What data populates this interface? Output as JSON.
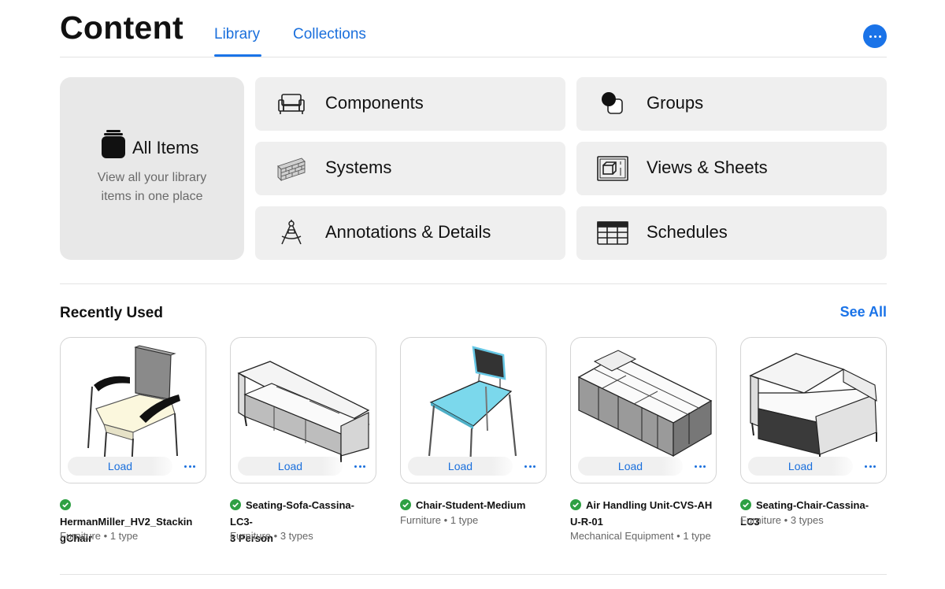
{
  "header": {
    "title": "Content",
    "tabs": [
      {
        "label": "Library",
        "active": true
      },
      {
        "label": "Collections",
        "active": false
      }
    ],
    "more_icon": "more-horizontal-icon"
  },
  "all_items": {
    "title": "All Items",
    "description_line1": "View all your library",
    "description_line2": "items in one place",
    "icon": "stack-icon"
  },
  "categories": [
    {
      "label": "Components",
      "icon": "armchair-icon"
    },
    {
      "label": "Groups",
      "icon": "groups-icon"
    },
    {
      "label": "Systems",
      "icon": "brick-wall-icon"
    },
    {
      "label": "Views & Sheets",
      "icon": "views-sheets-icon"
    },
    {
      "label": "Annotations & Details",
      "icon": "drafting-compass-icon"
    },
    {
      "label": "Schedules",
      "icon": "table-icon"
    }
  ],
  "recent": {
    "title": "Recently Used",
    "see_all_label": "See All",
    "load_label": "Load",
    "items": [
      {
        "name_line1": "HermanMiller_HV2_Stackin",
        "name_line2": "gChair",
        "category": "Furniture",
        "types": "1 type",
        "separator": "•",
        "status_icon": "check-circle-icon",
        "thumbnail": "stacking-chair-icon"
      },
      {
        "name_line1": "Seating-Sofa-Cassina-LC3-",
        "name_line2": "3 Person",
        "category": "Furniture",
        "types": "3 types",
        "separator": "•",
        "status_icon": "check-circle-icon",
        "thumbnail": "sofa-icon"
      },
      {
        "name_line1": "Chair-Student-Medium",
        "name_line2": "",
        "category": "Furniture",
        "types": "1 type",
        "separator": "•",
        "status_icon": "check-circle-icon",
        "thumbnail": "student-chair-icon"
      },
      {
        "name_line1": "Air Handling Unit-CVS-AH",
        "name_line2": "U-R-01",
        "category": "Mechanical Equipment",
        "types": "1 type",
        "separator": "•",
        "status_icon": "check-circle-icon",
        "thumbnail": "air-handling-unit-icon"
      },
      {
        "name_line1": "Seating-Chair-Cassina-LC3",
        "name_line2": "",
        "category": "Furniture",
        "types": "3 types",
        "separator": "•",
        "status_icon": "check-circle-icon",
        "thumbnail": "lounge-chair-icon"
      }
    ]
  },
  "colors": {
    "accent": "#1a73e8",
    "success": "#2ea043",
    "tile_bg": "#efefef",
    "hero_bg": "#e8e8e8"
  }
}
